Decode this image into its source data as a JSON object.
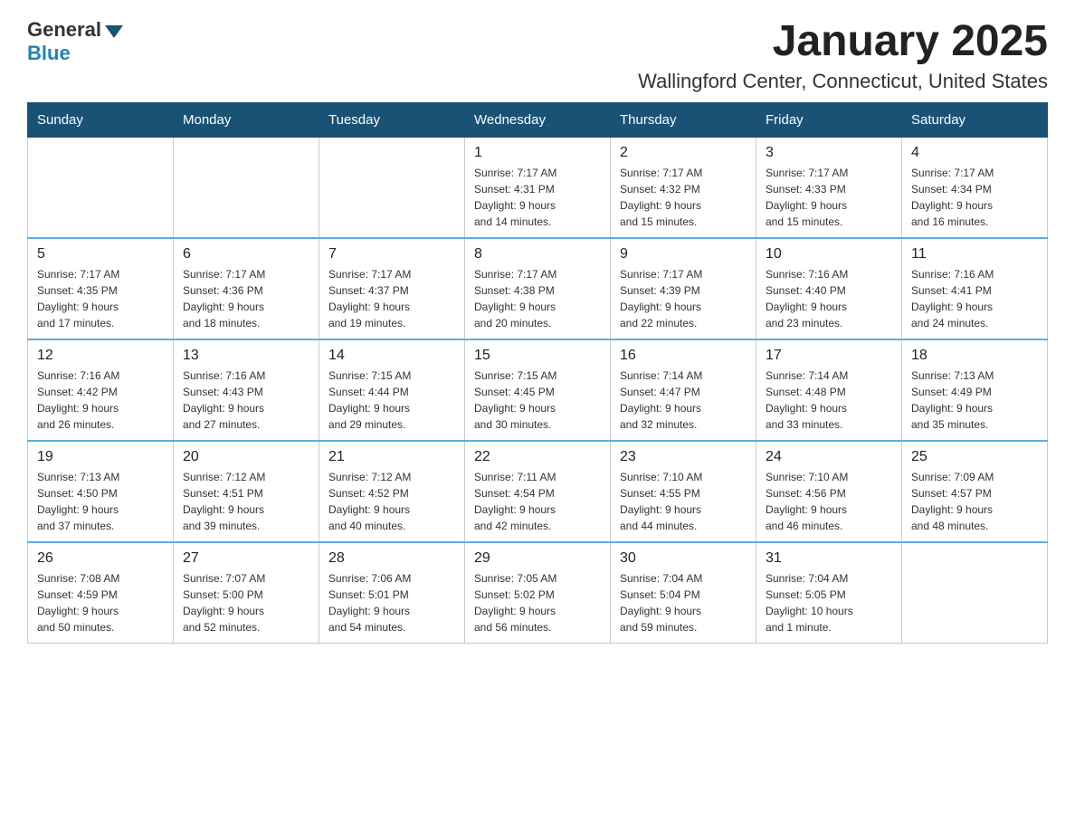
{
  "header": {
    "logo_general": "General",
    "logo_blue": "Blue",
    "month_year": "January 2025",
    "location": "Wallingford Center, Connecticut, United States"
  },
  "days_of_week": [
    "Sunday",
    "Monday",
    "Tuesday",
    "Wednesday",
    "Thursday",
    "Friday",
    "Saturday"
  ],
  "weeks": [
    [
      {
        "day": "",
        "info": ""
      },
      {
        "day": "",
        "info": ""
      },
      {
        "day": "",
        "info": ""
      },
      {
        "day": "1",
        "info": "Sunrise: 7:17 AM\nSunset: 4:31 PM\nDaylight: 9 hours\nand 14 minutes."
      },
      {
        "day": "2",
        "info": "Sunrise: 7:17 AM\nSunset: 4:32 PM\nDaylight: 9 hours\nand 15 minutes."
      },
      {
        "day": "3",
        "info": "Sunrise: 7:17 AM\nSunset: 4:33 PM\nDaylight: 9 hours\nand 15 minutes."
      },
      {
        "day": "4",
        "info": "Sunrise: 7:17 AM\nSunset: 4:34 PM\nDaylight: 9 hours\nand 16 minutes."
      }
    ],
    [
      {
        "day": "5",
        "info": "Sunrise: 7:17 AM\nSunset: 4:35 PM\nDaylight: 9 hours\nand 17 minutes."
      },
      {
        "day": "6",
        "info": "Sunrise: 7:17 AM\nSunset: 4:36 PM\nDaylight: 9 hours\nand 18 minutes."
      },
      {
        "day": "7",
        "info": "Sunrise: 7:17 AM\nSunset: 4:37 PM\nDaylight: 9 hours\nand 19 minutes."
      },
      {
        "day": "8",
        "info": "Sunrise: 7:17 AM\nSunset: 4:38 PM\nDaylight: 9 hours\nand 20 minutes."
      },
      {
        "day": "9",
        "info": "Sunrise: 7:17 AM\nSunset: 4:39 PM\nDaylight: 9 hours\nand 22 minutes."
      },
      {
        "day": "10",
        "info": "Sunrise: 7:16 AM\nSunset: 4:40 PM\nDaylight: 9 hours\nand 23 minutes."
      },
      {
        "day": "11",
        "info": "Sunrise: 7:16 AM\nSunset: 4:41 PM\nDaylight: 9 hours\nand 24 minutes."
      }
    ],
    [
      {
        "day": "12",
        "info": "Sunrise: 7:16 AM\nSunset: 4:42 PM\nDaylight: 9 hours\nand 26 minutes."
      },
      {
        "day": "13",
        "info": "Sunrise: 7:16 AM\nSunset: 4:43 PM\nDaylight: 9 hours\nand 27 minutes."
      },
      {
        "day": "14",
        "info": "Sunrise: 7:15 AM\nSunset: 4:44 PM\nDaylight: 9 hours\nand 29 minutes."
      },
      {
        "day": "15",
        "info": "Sunrise: 7:15 AM\nSunset: 4:45 PM\nDaylight: 9 hours\nand 30 minutes."
      },
      {
        "day": "16",
        "info": "Sunrise: 7:14 AM\nSunset: 4:47 PM\nDaylight: 9 hours\nand 32 minutes."
      },
      {
        "day": "17",
        "info": "Sunrise: 7:14 AM\nSunset: 4:48 PM\nDaylight: 9 hours\nand 33 minutes."
      },
      {
        "day": "18",
        "info": "Sunrise: 7:13 AM\nSunset: 4:49 PM\nDaylight: 9 hours\nand 35 minutes."
      }
    ],
    [
      {
        "day": "19",
        "info": "Sunrise: 7:13 AM\nSunset: 4:50 PM\nDaylight: 9 hours\nand 37 minutes."
      },
      {
        "day": "20",
        "info": "Sunrise: 7:12 AM\nSunset: 4:51 PM\nDaylight: 9 hours\nand 39 minutes."
      },
      {
        "day": "21",
        "info": "Sunrise: 7:12 AM\nSunset: 4:52 PM\nDaylight: 9 hours\nand 40 minutes."
      },
      {
        "day": "22",
        "info": "Sunrise: 7:11 AM\nSunset: 4:54 PM\nDaylight: 9 hours\nand 42 minutes."
      },
      {
        "day": "23",
        "info": "Sunrise: 7:10 AM\nSunset: 4:55 PM\nDaylight: 9 hours\nand 44 minutes."
      },
      {
        "day": "24",
        "info": "Sunrise: 7:10 AM\nSunset: 4:56 PM\nDaylight: 9 hours\nand 46 minutes."
      },
      {
        "day": "25",
        "info": "Sunrise: 7:09 AM\nSunset: 4:57 PM\nDaylight: 9 hours\nand 48 minutes."
      }
    ],
    [
      {
        "day": "26",
        "info": "Sunrise: 7:08 AM\nSunset: 4:59 PM\nDaylight: 9 hours\nand 50 minutes."
      },
      {
        "day": "27",
        "info": "Sunrise: 7:07 AM\nSunset: 5:00 PM\nDaylight: 9 hours\nand 52 minutes."
      },
      {
        "day": "28",
        "info": "Sunrise: 7:06 AM\nSunset: 5:01 PM\nDaylight: 9 hours\nand 54 minutes."
      },
      {
        "day": "29",
        "info": "Sunrise: 7:05 AM\nSunset: 5:02 PM\nDaylight: 9 hours\nand 56 minutes."
      },
      {
        "day": "30",
        "info": "Sunrise: 7:04 AM\nSunset: 5:04 PM\nDaylight: 9 hours\nand 59 minutes."
      },
      {
        "day": "31",
        "info": "Sunrise: 7:04 AM\nSunset: 5:05 PM\nDaylight: 10 hours\nand 1 minute."
      },
      {
        "day": "",
        "info": ""
      }
    ]
  ]
}
